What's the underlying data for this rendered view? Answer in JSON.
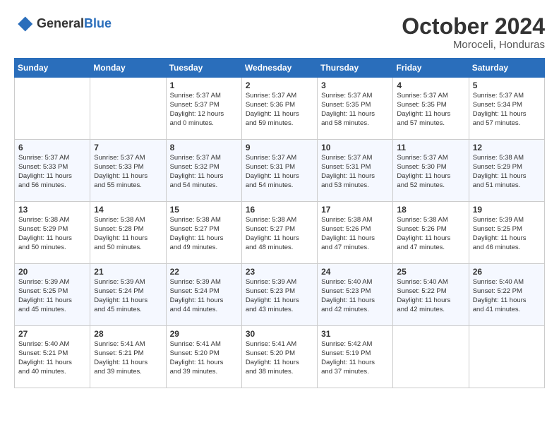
{
  "logo": {
    "general": "General",
    "blue": "Blue"
  },
  "title": "October 2024",
  "subtitle": "Moroceli, Honduras",
  "headers": [
    "Sunday",
    "Monday",
    "Tuesday",
    "Wednesday",
    "Thursday",
    "Friday",
    "Saturday"
  ],
  "weeks": [
    [
      {
        "day": "",
        "info": ""
      },
      {
        "day": "",
        "info": ""
      },
      {
        "day": "1",
        "info": "Sunrise: 5:37 AM\nSunset: 5:37 PM\nDaylight: 12 hours\nand 0 minutes."
      },
      {
        "day": "2",
        "info": "Sunrise: 5:37 AM\nSunset: 5:36 PM\nDaylight: 11 hours\nand 59 minutes."
      },
      {
        "day": "3",
        "info": "Sunrise: 5:37 AM\nSunset: 5:35 PM\nDaylight: 11 hours\nand 58 minutes."
      },
      {
        "day": "4",
        "info": "Sunrise: 5:37 AM\nSunset: 5:35 PM\nDaylight: 11 hours\nand 57 minutes."
      },
      {
        "day": "5",
        "info": "Sunrise: 5:37 AM\nSunset: 5:34 PM\nDaylight: 11 hours\nand 57 minutes."
      }
    ],
    [
      {
        "day": "6",
        "info": "Sunrise: 5:37 AM\nSunset: 5:33 PM\nDaylight: 11 hours\nand 56 minutes."
      },
      {
        "day": "7",
        "info": "Sunrise: 5:37 AM\nSunset: 5:33 PM\nDaylight: 11 hours\nand 55 minutes."
      },
      {
        "day": "8",
        "info": "Sunrise: 5:37 AM\nSunset: 5:32 PM\nDaylight: 11 hours\nand 54 minutes."
      },
      {
        "day": "9",
        "info": "Sunrise: 5:37 AM\nSunset: 5:31 PM\nDaylight: 11 hours\nand 54 minutes."
      },
      {
        "day": "10",
        "info": "Sunrise: 5:37 AM\nSunset: 5:31 PM\nDaylight: 11 hours\nand 53 minutes."
      },
      {
        "day": "11",
        "info": "Sunrise: 5:37 AM\nSunset: 5:30 PM\nDaylight: 11 hours\nand 52 minutes."
      },
      {
        "day": "12",
        "info": "Sunrise: 5:38 AM\nSunset: 5:29 PM\nDaylight: 11 hours\nand 51 minutes."
      }
    ],
    [
      {
        "day": "13",
        "info": "Sunrise: 5:38 AM\nSunset: 5:29 PM\nDaylight: 11 hours\nand 50 minutes."
      },
      {
        "day": "14",
        "info": "Sunrise: 5:38 AM\nSunset: 5:28 PM\nDaylight: 11 hours\nand 50 minutes."
      },
      {
        "day": "15",
        "info": "Sunrise: 5:38 AM\nSunset: 5:27 PM\nDaylight: 11 hours\nand 49 minutes."
      },
      {
        "day": "16",
        "info": "Sunrise: 5:38 AM\nSunset: 5:27 PM\nDaylight: 11 hours\nand 48 minutes."
      },
      {
        "day": "17",
        "info": "Sunrise: 5:38 AM\nSunset: 5:26 PM\nDaylight: 11 hours\nand 47 minutes."
      },
      {
        "day": "18",
        "info": "Sunrise: 5:38 AM\nSunset: 5:26 PM\nDaylight: 11 hours\nand 47 minutes."
      },
      {
        "day": "19",
        "info": "Sunrise: 5:39 AM\nSunset: 5:25 PM\nDaylight: 11 hours\nand 46 minutes."
      }
    ],
    [
      {
        "day": "20",
        "info": "Sunrise: 5:39 AM\nSunset: 5:25 PM\nDaylight: 11 hours\nand 45 minutes."
      },
      {
        "day": "21",
        "info": "Sunrise: 5:39 AM\nSunset: 5:24 PM\nDaylight: 11 hours\nand 45 minutes."
      },
      {
        "day": "22",
        "info": "Sunrise: 5:39 AM\nSunset: 5:24 PM\nDaylight: 11 hours\nand 44 minutes."
      },
      {
        "day": "23",
        "info": "Sunrise: 5:39 AM\nSunset: 5:23 PM\nDaylight: 11 hours\nand 43 minutes."
      },
      {
        "day": "24",
        "info": "Sunrise: 5:40 AM\nSunset: 5:23 PM\nDaylight: 11 hours\nand 42 minutes."
      },
      {
        "day": "25",
        "info": "Sunrise: 5:40 AM\nSunset: 5:22 PM\nDaylight: 11 hours\nand 42 minutes."
      },
      {
        "day": "26",
        "info": "Sunrise: 5:40 AM\nSunset: 5:22 PM\nDaylight: 11 hours\nand 41 minutes."
      }
    ],
    [
      {
        "day": "27",
        "info": "Sunrise: 5:40 AM\nSunset: 5:21 PM\nDaylight: 11 hours\nand 40 minutes."
      },
      {
        "day": "28",
        "info": "Sunrise: 5:41 AM\nSunset: 5:21 PM\nDaylight: 11 hours\nand 39 minutes."
      },
      {
        "day": "29",
        "info": "Sunrise: 5:41 AM\nSunset: 5:20 PM\nDaylight: 11 hours\nand 39 minutes."
      },
      {
        "day": "30",
        "info": "Sunrise: 5:41 AM\nSunset: 5:20 PM\nDaylight: 11 hours\nand 38 minutes."
      },
      {
        "day": "31",
        "info": "Sunrise: 5:42 AM\nSunset: 5:19 PM\nDaylight: 11 hours\nand 37 minutes."
      },
      {
        "day": "",
        "info": ""
      },
      {
        "day": "",
        "info": ""
      }
    ]
  ]
}
